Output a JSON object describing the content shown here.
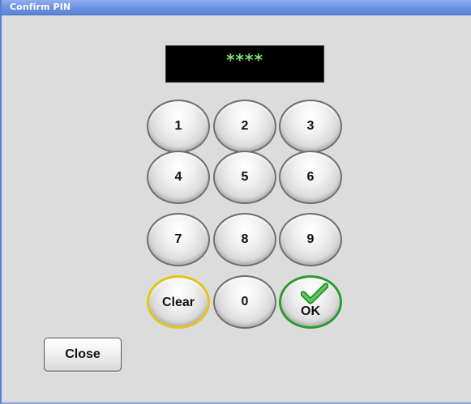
{
  "window": {
    "title": "Confirm PIN"
  },
  "pin": {
    "masked_value": "****"
  },
  "keypad": {
    "keys": [
      {
        "label": "1"
      },
      {
        "label": "2"
      },
      {
        "label": "3"
      },
      {
        "label": "4"
      },
      {
        "label": "5"
      },
      {
        "label": "6"
      },
      {
        "label": "7"
      },
      {
        "label": "8"
      },
      {
        "label": "9"
      },
      {
        "label": "Clear"
      },
      {
        "label": "0"
      },
      {
        "label": "OK"
      }
    ],
    "clear_accent": "#e3c51a",
    "ok_accent": "#2f9a2f",
    "ok_icon": "check-icon"
  },
  "footer": {
    "close_label": "Close"
  },
  "colors": {
    "titlebar": "#6f95e2",
    "window_bg": "#dcdcdc",
    "display_bg": "#000000",
    "display_text": "#7be07b"
  }
}
